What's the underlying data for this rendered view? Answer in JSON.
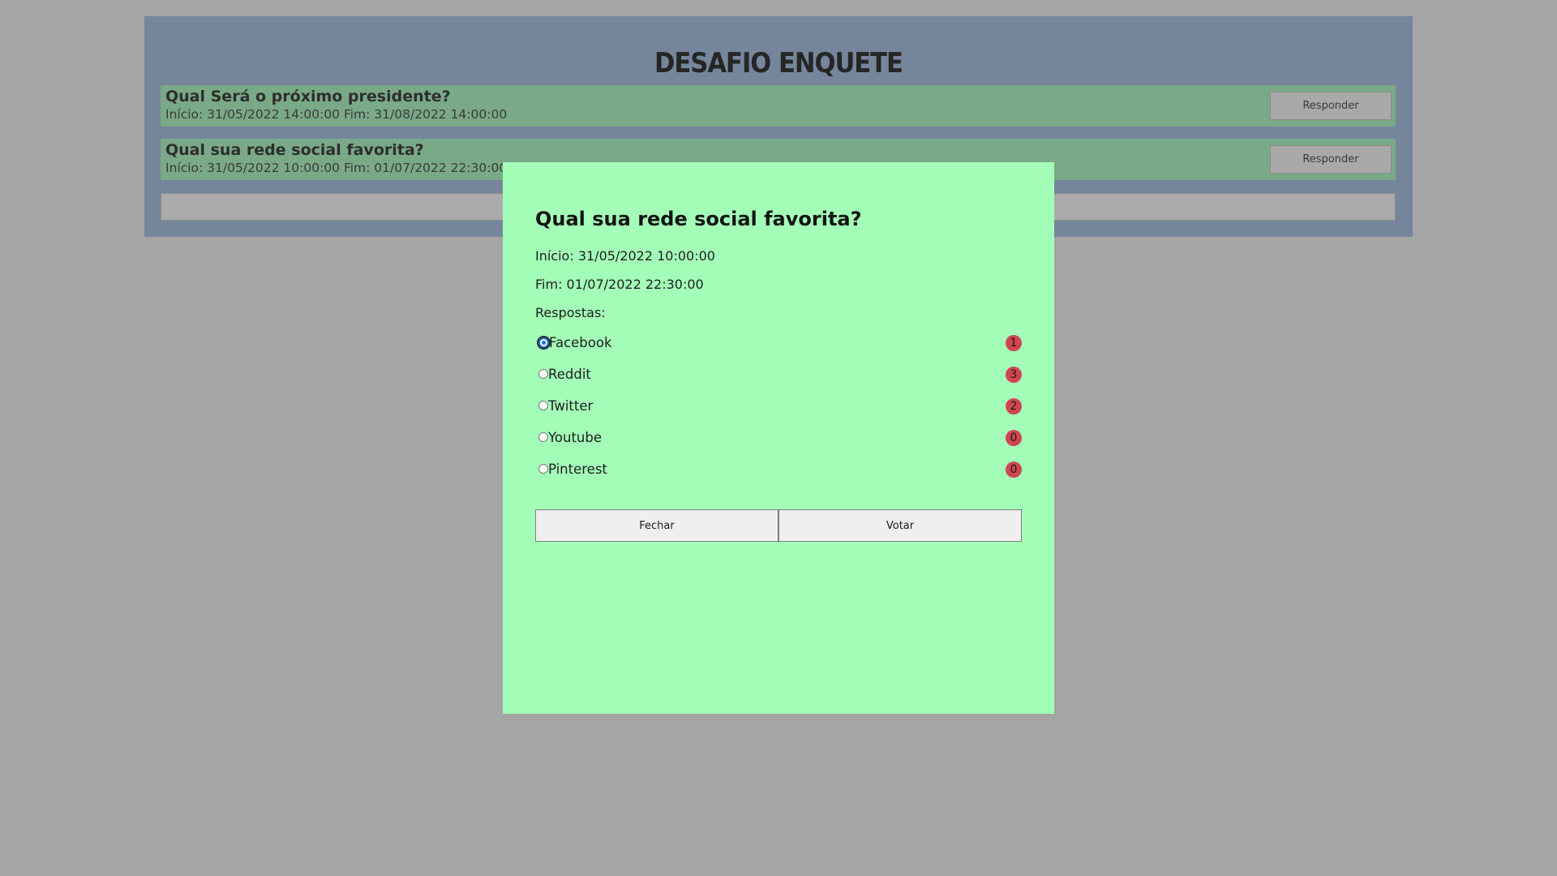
{
  "app": {
    "title": "DESAFIO ENQUETE"
  },
  "polls": [
    {
      "question": "Qual Será o próximo presidente?",
      "dates": "Início: 31/05/2022 14:00:00 Fim: 31/08/2022 14:00:00",
      "button": "Responder"
    },
    {
      "question": "Qual sua rede social favorita?",
      "dates": "Início: 31/05/2022 10:00:00 Fim: 01/07/2022 22:30:00",
      "button": "Responder"
    }
  ],
  "modal": {
    "title": "Qual sua rede social favorita?",
    "start": "Início: 31/05/2022 10:00:00",
    "end": "Fim: 01/07/2022 22:30:00",
    "answers_label": "Respostas:",
    "options": [
      {
        "label": "Facebook",
        "count": "1",
        "checked": true
      },
      {
        "label": "Reddit",
        "count": "3",
        "checked": false
      },
      {
        "label": "Twitter",
        "count": "2",
        "checked": false
      },
      {
        "label": "Youtube",
        "count": "0",
        "checked": false
      },
      {
        "label": "Pinterest",
        "count": "0",
        "checked": false
      }
    ],
    "close_label": "Fechar",
    "vote_label": "Votar"
  },
  "colors": {
    "page_bg": "#a4a5a4",
    "panel_bg": "#75869c",
    "poll_row_bg": "#7aa987",
    "modal_bg": "#a3feb7",
    "badge_bg": "#d04650"
  }
}
